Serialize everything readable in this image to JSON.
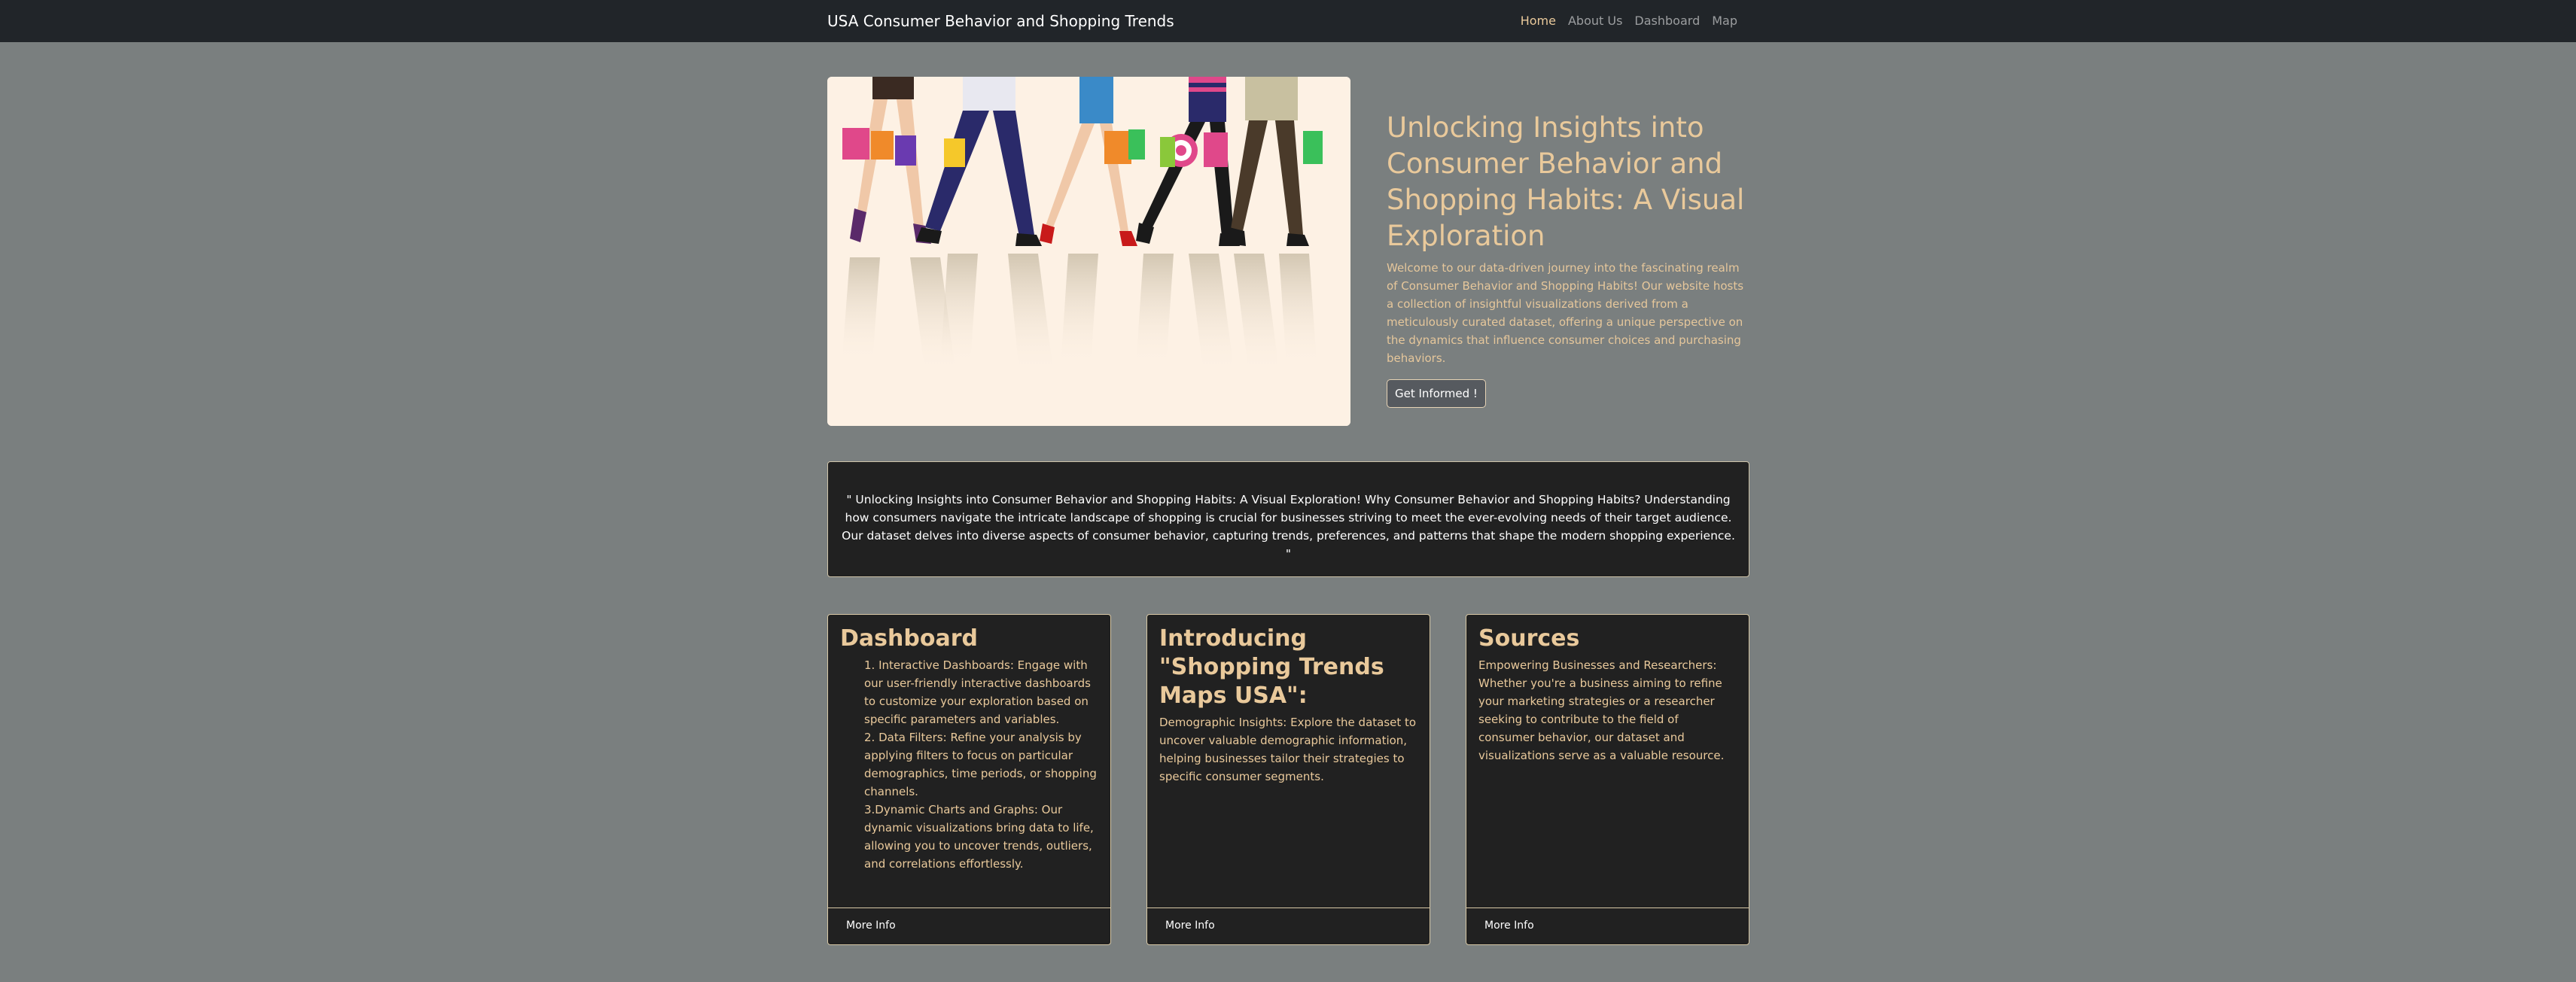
{
  "navbar": {
    "brand": "USA Consumer Behavior and Shopping Trends",
    "links": [
      {
        "label": "Home",
        "active": true
      },
      {
        "label": "About Us",
        "active": false
      },
      {
        "label": "Dashboard",
        "active": false
      },
      {
        "label": "Map",
        "active": false
      }
    ]
  },
  "hero": {
    "image_alt": "shoppers-with-bags-illustration",
    "title": "Unlocking Insights into Consumer Behavior and Shopping Habits: A Visual Exploration",
    "lead": "Welcome to our data-driven journey into the fascinating realm of Consumer Behavior and Shopping Habits! Our website hosts a collection of insightful visualizations derived from a meticulously curated dataset, offering a unique perspective on the dynamics that influence consumer choices and purchasing behaviors.",
    "button_label": "Get Informed !"
  },
  "quote": {
    "text": "\" Unlocking Insights into Consumer Behavior and Shopping Habits: A Visual Exploration! Why Consumer Behavior and Shopping Habits? Understanding how consumers navigate the intricate landscape of shopping is crucial for businesses striving to meet the ever-evolving needs of their target audience. Our dataset delves into diverse aspects of consumer behavior, capturing trends, preferences, and patterns that shape the modern shopping experience. \""
  },
  "cards": [
    {
      "title": "Dashboard",
      "items": [
        "1. Interactive Dashboards: Engage with our user-friendly interactive dashboards to customize your exploration based on specific parameters and variables.",
        "2. Data Filters: Refine your analysis by applying filters to focus on particular demographics, time periods, or shopping channels.",
        "3.Dynamic Charts and Graphs: Our dynamic visualizations bring data to life, allowing you to uncover trends, outliers, and correlations effortlessly."
      ],
      "button_label": "More Info"
    },
    {
      "title": "Introducing \"Shopping Trends Maps USA\":",
      "text": "Demographic Insights: Explore the dataset to uncover valuable demographic information, helping businesses tailor their strategies to specific consumer segments.",
      "button_label": "More Info"
    },
    {
      "title": "Sources",
      "text": "Empowering Businesses and Researchers: Whether you're a business aiming to refine your marketing strategies or a researcher seeking to contribute to the field of consumer behavior, our dataset and visualizations serve as a valuable resource.",
      "button_label": "More Info"
    }
  ],
  "colors": {
    "page_bg": "#7a7f7f",
    "navbar_bg": "#212529",
    "accent_text": "#e9c99b",
    "card_bg": "#212121"
  }
}
